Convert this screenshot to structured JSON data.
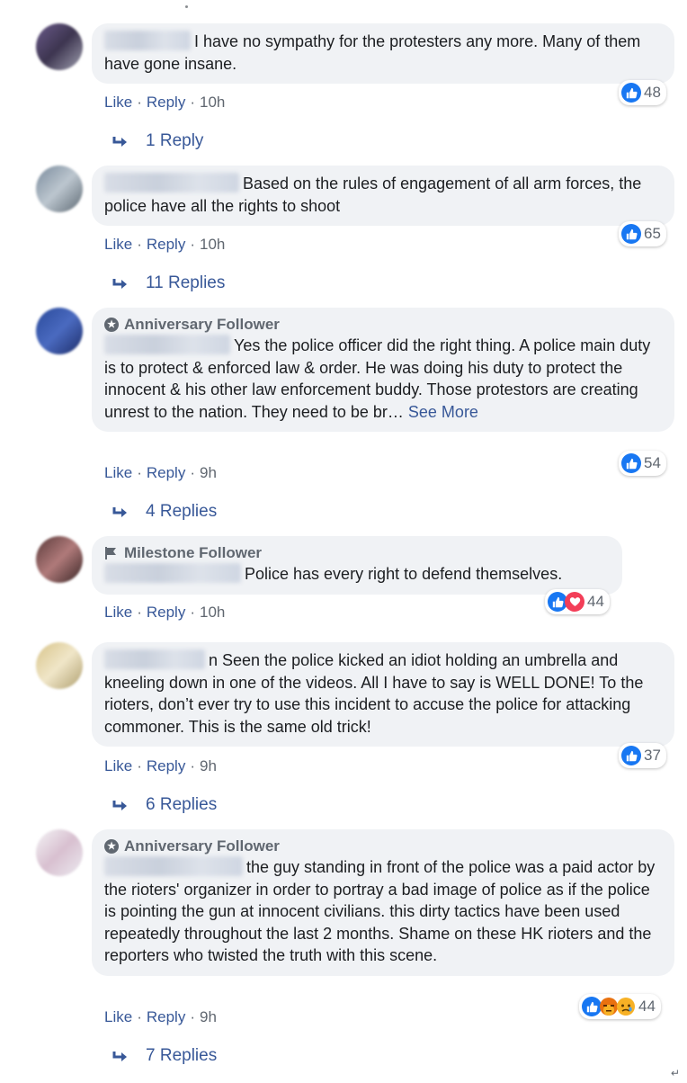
{
  "comments": [
    {
      "badge": "",
      "text": "I have no sympathy for the protesters any more. Many of them have gone insane.",
      "reaction_count": "48",
      "reactions": [
        "like"
      ],
      "actions": {
        "like": "Like",
        "reply": "Reply",
        "time": "10h"
      },
      "replies": "1 Reply"
    },
    {
      "badge": "",
      "text": "Based on the rules of engagement of all arm forces, the police have all the rights to shoot",
      "reaction_count": "65",
      "reactions": [
        "like"
      ],
      "actions": {
        "like": "Like",
        "reply": "Reply",
        "time": "10h"
      },
      "replies": "11 Replies"
    },
    {
      "badge": "Anniversary Follower",
      "text": "Yes the police officer did the right thing. A police main duty is to protect & enforced law & order. He was doing his duty to protect the innocent & his other law enforcement buddy. Those protestors are creating unrest to the nation. They need to be br…",
      "see_more": "See More",
      "reaction_count": "54",
      "reactions": [
        "like"
      ],
      "actions": {
        "like": "Like",
        "reply": "Reply",
        "time": "9h"
      },
      "replies": "4 Replies"
    },
    {
      "badge": "Milestone Follower",
      "text": "Police has every right to defend themselves.",
      "reaction_count": "44",
      "reactions": [
        "like",
        "love"
      ],
      "actions": {
        "like": "Like",
        "reply": "Reply",
        "time": "10h"
      },
      "replies": ""
    },
    {
      "badge": "",
      "text": "n Seen the police kicked an idiot holding an umbrella and kneeling down in one of the videos. All I have to say is WELL DONE! To the rioters, don’t ever try to use this incident to accuse the police for attacking commoner. This is the same old trick!",
      "reaction_count": "37",
      "reactions": [
        "like"
      ],
      "actions": {
        "like": "Like",
        "reply": "Reply",
        "time": "9h"
      },
      "replies": "6 Replies"
    },
    {
      "badge": "Anniversary Follower",
      "text": "the guy standing in front of the police was a paid actor by the rioters' organizer in order to portray a bad image of police as if the police is pointing the gun at innocent civilians. this dirty tactics have been used repeatedly throughout the last 2 months. Shame on these HK rioters and the reporters who twisted the truth with this scene.",
      "reaction_count": "44",
      "reactions": [
        "like",
        "angry",
        "sad"
      ],
      "actions": {
        "like": "Like",
        "reply": "Reply",
        "time": "9h"
      },
      "replies": "7 Replies"
    }
  ],
  "colors": {
    "bubble": "#f0f2f5",
    "link": "#385898",
    "meta": "#606770",
    "like": "#1877f2",
    "love": "#f33e58"
  }
}
